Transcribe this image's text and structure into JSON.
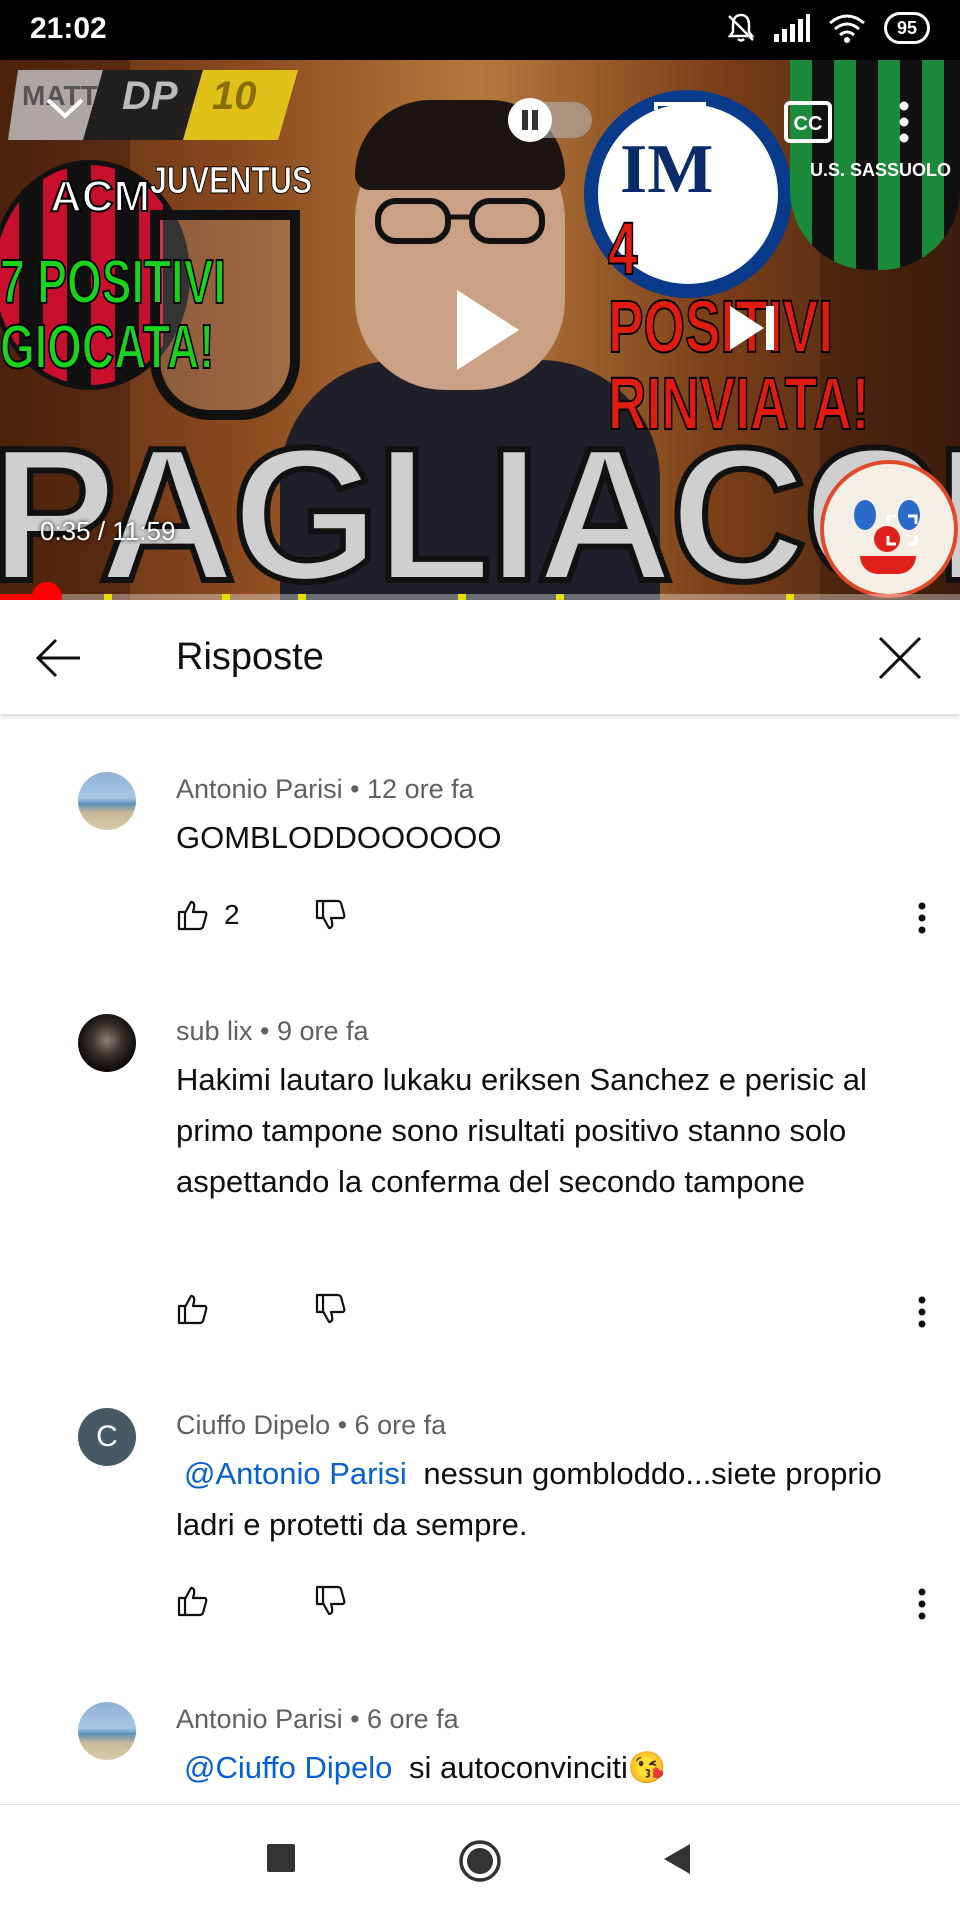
{
  "status_bar": {
    "time": "21:02",
    "battery": "95"
  },
  "player": {
    "thumbnail": {
      "brand": [
        "MATT",
        "DP",
        "10"
      ],
      "green_lines": [
        "7 POSITIVI",
        "GIOCATA!"
      ],
      "red_lines": [
        "4 POSITIVI",
        "RINVIATA!"
      ],
      "juventus": "JUVENTUS",
      "acm": "ACM",
      "sassuolo": "U.S. SASSUOLO",
      "title": "PAGLIACCI"
    },
    "time": "0:35 / 11:59",
    "progress": 0.049
  },
  "header": {
    "title": "Risposte"
  },
  "comments": [
    {
      "author": "Antonio Parisi",
      "age": "12 ore fa",
      "meta": "Antonio Parisi • 12 ore fa",
      "text": "GOMBLODDOOOOOO",
      "likes": "2",
      "avatar": "beach-photo"
    },
    {
      "author": "sub lix",
      "age": "9 ore fa",
      "meta": "sub lix • 9 ore fa",
      "text": "Hakimi lautaro lukaku eriksen Sanchez e perisic al primo tampone sono risultati positivo stanno solo aspettando la conferma del secondo tampone",
      "likes": "",
      "avatar": "dark-photo"
    },
    {
      "author": "Ciuffo Dipelo",
      "age": "6 ore fa",
      "meta": "Ciuffo Dipelo • 6 ore fa",
      "mention": "@Antonio Parisi",
      "text": "nessun gombloddo...siete proprio ladri e protetti da sempre.",
      "likes": "",
      "avatar": "C"
    },
    {
      "author": "Antonio Parisi",
      "age": "6 ore fa",
      "meta": "Antonio Parisi • 6 ore fa",
      "mention": "@Ciuffo Dipelo",
      "text": "si autoconvinciti😘",
      "likes": "",
      "avatar": "beach-photo"
    }
  ],
  "colors": {
    "accent": "#ff0000",
    "mention": "#065fd4",
    "meta": "#606060"
  }
}
